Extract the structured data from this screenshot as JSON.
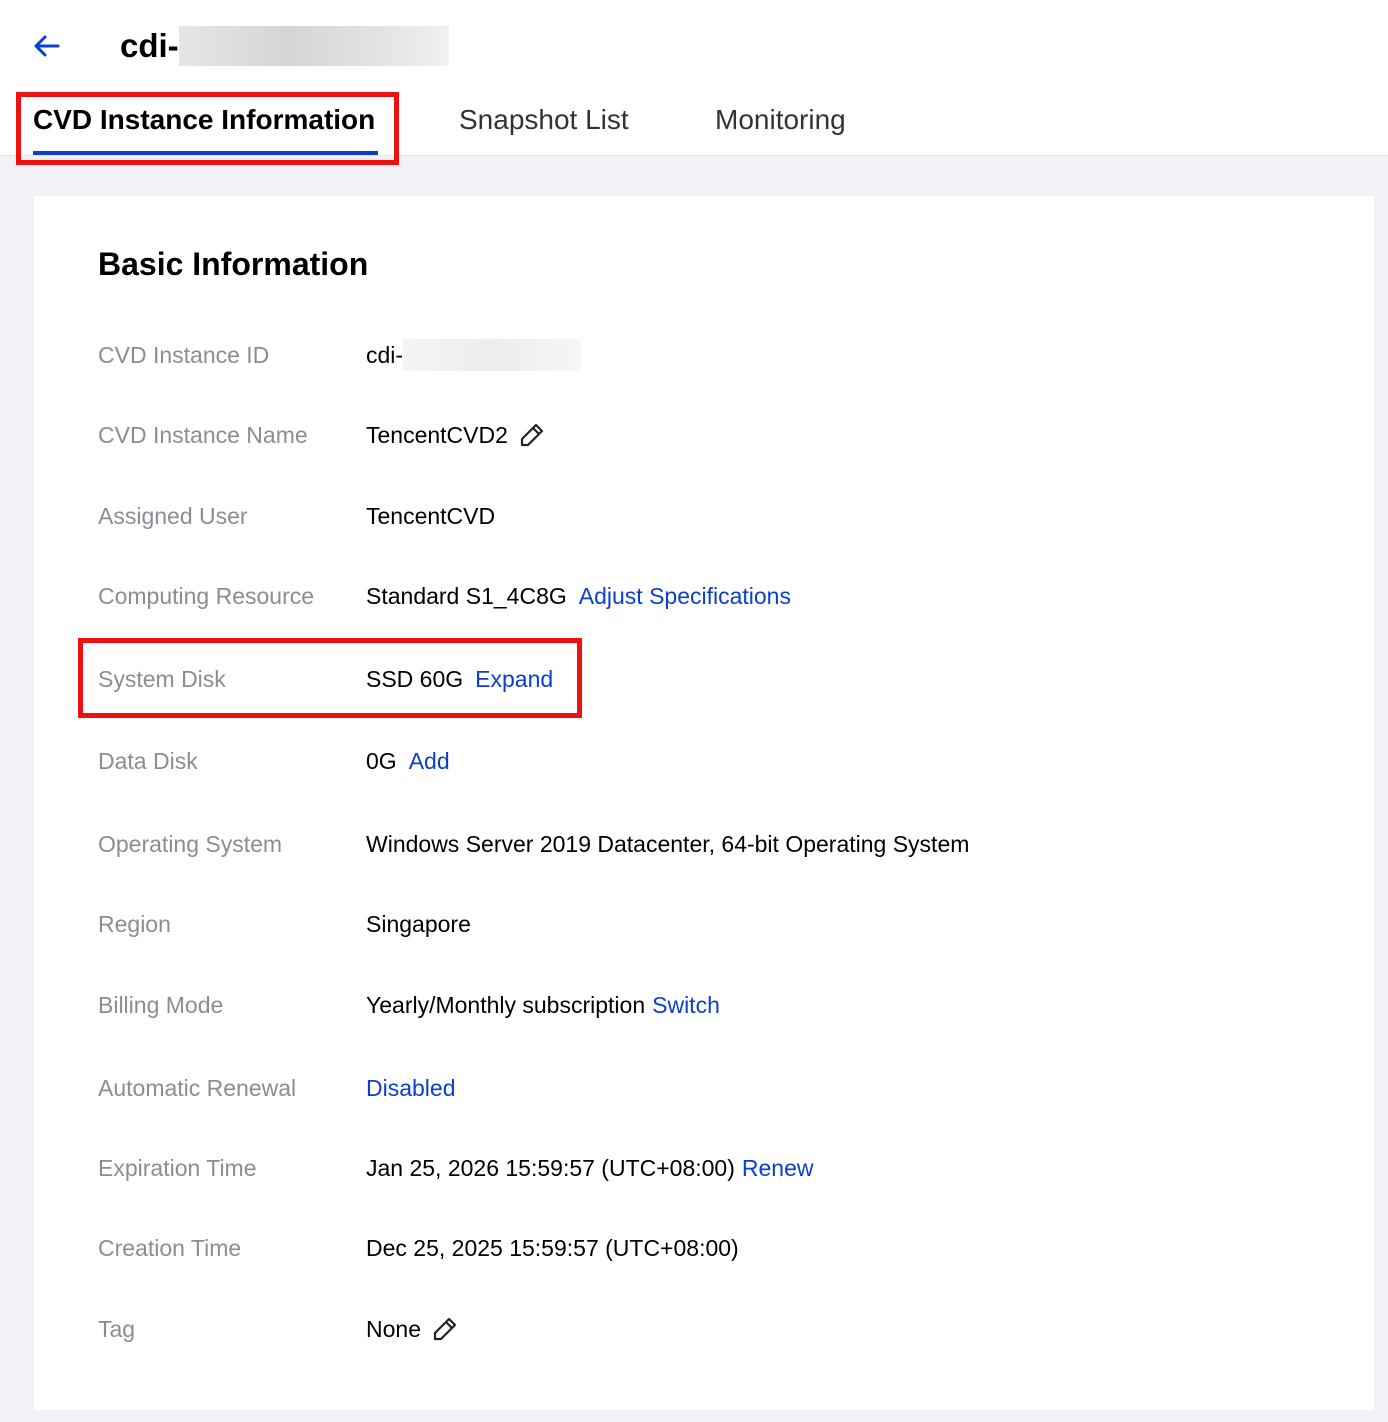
{
  "header": {
    "title_prefix": "cdi-",
    "back_icon": "arrow-left-icon"
  },
  "tabs": [
    {
      "label": "CVD Instance Information",
      "active": true
    },
    {
      "label": "Snapshot List",
      "active": false
    },
    {
      "label": "Monitoring",
      "active": false
    }
  ],
  "basic_info": {
    "title": "Basic Information",
    "instance_id": {
      "label": "CVD Instance ID",
      "value": "cdi-"
    },
    "instance_name": {
      "label": "CVD Instance Name",
      "value": "TencentCVD2",
      "icon": "pencil-icon"
    },
    "assigned_user": {
      "label": "Assigned User",
      "value": "TencentCVD"
    },
    "computing_resource": {
      "label": "Computing Resource",
      "value": "Standard S1_4C8G",
      "action": "Adjust Specifications"
    },
    "system_disk": {
      "label": "System Disk",
      "value": "SSD 60G",
      "action": "Expand"
    },
    "data_disk": {
      "label": "Data Disk",
      "value": "0G",
      "action": "Add"
    },
    "os": {
      "label": "Operating System",
      "value": "Windows Server 2019 Datacenter, 64-bit Operating System"
    },
    "region": {
      "label": "Region",
      "value": "Singapore"
    },
    "billing_mode": {
      "label": "Billing Mode",
      "value": "Yearly/Monthly subscription",
      "action": "Switch"
    },
    "auto_renewal": {
      "label": "Automatic Renewal",
      "action": "Disabled"
    },
    "expiration_time": {
      "label": "Expiration Time",
      "value": "Jan 25, 2026 15:59:57 (UTC+08:00)",
      "action": "Renew"
    },
    "creation_time": {
      "label": "Creation Time",
      "value": "Dec 25, 2025 15:59:57 (UTC+08:00)"
    },
    "tag": {
      "label": "Tag",
      "value": "None",
      "icon": "pencil-icon"
    }
  },
  "colors": {
    "link": "#0a3fcf",
    "highlight": "#ee1111",
    "label": "#8a8d93",
    "background": "#f1f2f5"
  }
}
